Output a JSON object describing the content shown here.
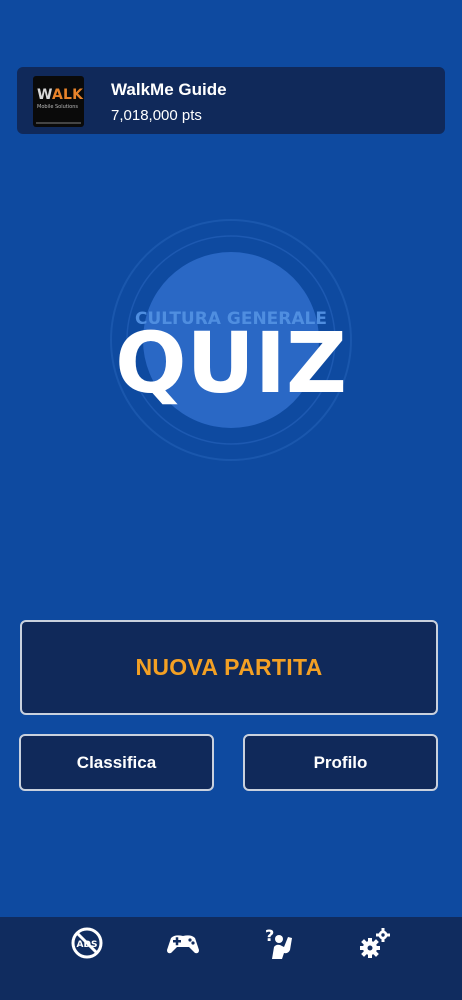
{
  "user": {
    "avatar_text_main": "WALKME",
    "avatar_text_sub": "Mobile Solutions",
    "name": "WalkMe Guide",
    "points": "7,018,000 pts"
  },
  "logo": {
    "subtitle": "CULTURA GENERALE",
    "title": "QUIZ"
  },
  "buttons": {
    "new_game": "NUOVA PARTITA",
    "leaderboard": "Classifica",
    "profile": "Profilo"
  },
  "tabbar": {
    "items": [
      {
        "icon": "no-ads-icon"
      },
      {
        "icon": "gamepad-icon"
      },
      {
        "icon": "question-hand-icon"
      },
      {
        "icon": "settings-gears-icon"
      }
    ]
  },
  "colors": {
    "background": "#0e4aa0",
    "panel": "#10295a",
    "accent": "#f3a024",
    "circle": "#2a68c5"
  }
}
